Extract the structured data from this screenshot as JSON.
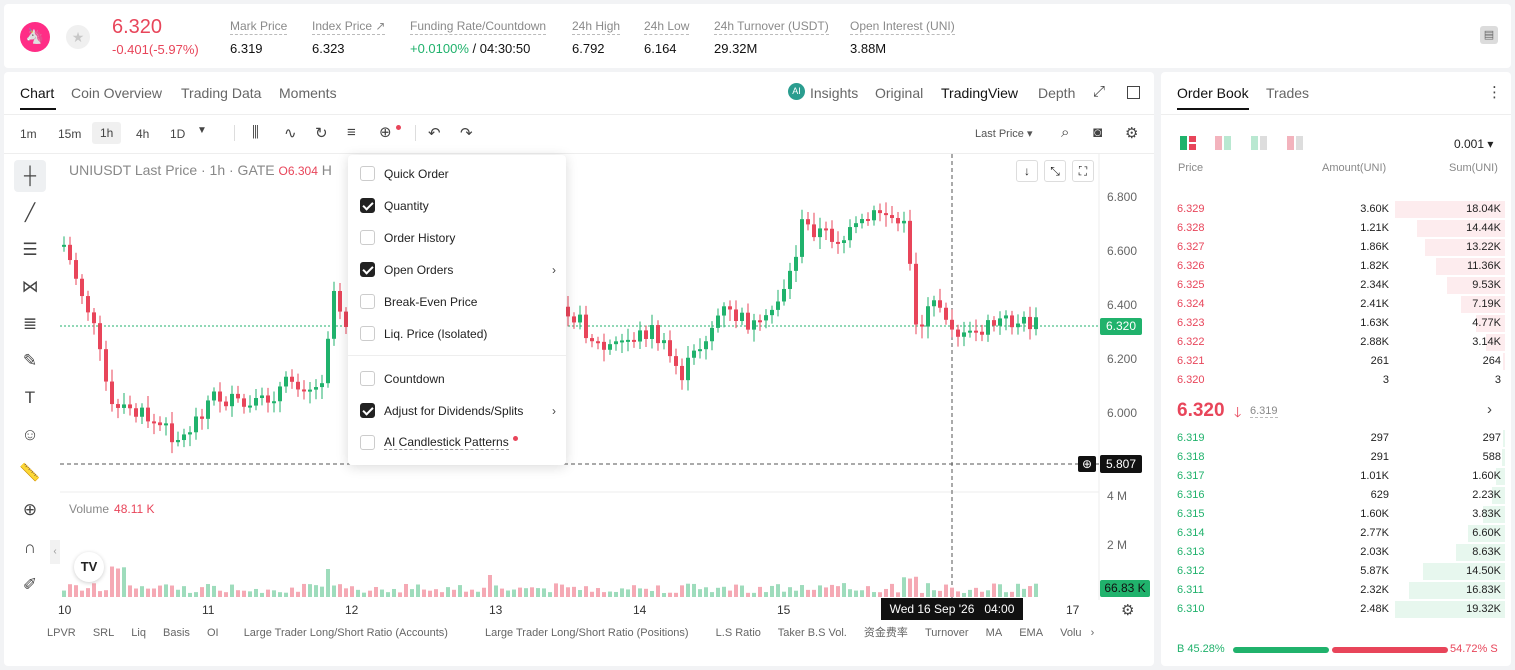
{
  "ticker": {
    "price": "6.320",
    "change": "-0.401(-5.97%)",
    "logo_icon": "unicorn-icon"
  },
  "stats": [
    {
      "label": "Mark Price",
      "value": "6.319"
    },
    {
      "label": "Index Price ↗",
      "value": "6.323"
    },
    {
      "label": "Funding Rate/Countdown",
      "value_green": "+0.0100%",
      "value": " / 04:30:50"
    },
    {
      "label": "24h High",
      "value": "6.792"
    },
    {
      "label": "24h Low",
      "value": "6.164"
    },
    {
      "label": "24h Turnover (USDT)",
      "value": "29.32M"
    },
    {
      "label": "Open Interest (UNI)",
      "value": "3.88M"
    }
  ],
  "chart_tabs": [
    "Chart",
    "Coin Overview",
    "Trading Data",
    "Moments"
  ],
  "view_tabs": {
    "insights": "Insights",
    "original": "Original",
    "tradingview": "TradingView",
    "depth": "Depth"
  },
  "timeframes": [
    "1m",
    "15m",
    "1h",
    "4h",
    "1D"
  ],
  "last_price_select": "Last Price",
  "legend": {
    "symbol": "UNIUSDT Last Price · 1h · GATE",
    "open": "O6.304",
    "h": "H"
  },
  "y_axis": [
    "6.800",
    "6.600",
    "6.400",
    "6.200",
    "6.000"
  ],
  "current_price_tag": "6.320",
  "crosshair_price": "5.807",
  "volume": {
    "label": "Volume",
    "value": "48.11 K",
    "ticks": [
      "4 M",
      "2 M"
    ],
    "tag": "66.83 K"
  },
  "x_axis": [
    "10",
    "11",
    "12",
    "13",
    "14",
    "15",
    "17"
  ],
  "crosshair_time": "Wed 16 Sep '26   04:00",
  "dropdown": [
    {
      "label": "Quick Order",
      "checked": false
    },
    {
      "label": "Quantity",
      "checked": true
    },
    {
      "label": "Order History",
      "checked": false
    },
    {
      "label": "Open Orders",
      "checked": true
    },
    {
      "label": "Break-Even Price",
      "checked": false
    },
    {
      "label": "Liq. Price (Isolated)",
      "checked": false
    },
    {
      "label": "Countdown",
      "checked": false
    },
    {
      "label": "Adjust for Dividends/Splits",
      "checked": true
    },
    {
      "label": "AI Candlestick Patterns",
      "checked": false
    }
  ],
  "indicators": [
    "LPVR",
    "SRL",
    "Liq",
    "Basis",
    "OI",
    "Large Trader Long/Short Ratio (Accounts)",
    "Large Trader Long/Short Ratio (Positions)",
    "L.S Ratio",
    "Taker B.S Vol.",
    "资金费率",
    "Turnover",
    "MA",
    "EMA",
    "Volu"
  ],
  "orderbook": {
    "tabs": [
      "Order Book",
      "Trades"
    ],
    "precision": "0.001",
    "headers": [
      "Price",
      "Amount(UNI)",
      "Sum(UNI)"
    ],
    "asks": [
      {
        "p": "6.329",
        "a": "3.60K",
        "s": "18.04K",
        "d": 1.0
      },
      {
        "p": "6.328",
        "a": "1.21K",
        "s": "14.44K",
        "d": 0.8
      },
      {
        "p": "6.327",
        "a": "1.86K",
        "s": "13.22K",
        "d": 0.73
      },
      {
        "p": "6.326",
        "a": "1.82K",
        "s": "11.36K",
        "d": 0.63
      },
      {
        "p": "6.325",
        "a": "2.34K",
        "s": "9.53K",
        "d": 0.53
      },
      {
        "p": "6.324",
        "a": "2.41K",
        "s": "7.19K",
        "d": 0.4
      },
      {
        "p": "6.323",
        "a": "1.63K",
        "s": "4.77K",
        "d": 0.26
      },
      {
        "p": "6.322",
        "a": "2.88K",
        "s": "3.14K",
        "d": 0.17
      },
      {
        "p": "6.321",
        "a": "261",
        "s": "264",
        "d": 0.015
      },
      {
        "p": "6.320",
        "a": "3",
        "s": "3",
        "d": 0.0
      }
    ],
    "mid": {
      "price": "6.320",
      "mark": "6.319"
    },
    "bids": [
      {
        "p": "6.319",
        "a": "297",
        "s": "297",
        "d": 0.015
      },
      {
        "p": "6.318",
        "a": "291",
        "s": "588",
        "d": 0.03
      },
      {
        "p": "6.317",
        "a": "1.01K",
        "s": "1.60K",
        "d": 0.08
      },
      {
        "p": "6.316",
        "a": "629",
        "s": "2.23K",
        "d": 0.12
      },
      {
        "p": "6.315",
        "a": "1.60K",
        "s": "3.83K",
        "d": 0.2
      },
      {
        "p": "6.314",
        "a": "2.77K",
        "s": "6.60K",
        "d": 0.34
      },
      {
        "p": "6.313",
        "a": "2.03K",
        "s": "8.63K",
        "d": 0.45
      },
      {
        "p": "6.312",
        "a": "5.87K",
        "s": "14.50K",
        "d": 0.75
      },
      {
        "p": "6.311",
        "a": "2.32K",
        "s": "16.83K",
        "d": 0.87
      },
      {
        "p": "6.310",
        "a": "2.48K",
        "s": "19.32K",
        "d": 1.0
      }
    ],
    "buy_ratio": "B 45.28%",
    "sell_ratio": "54.72% S"
  }
}
